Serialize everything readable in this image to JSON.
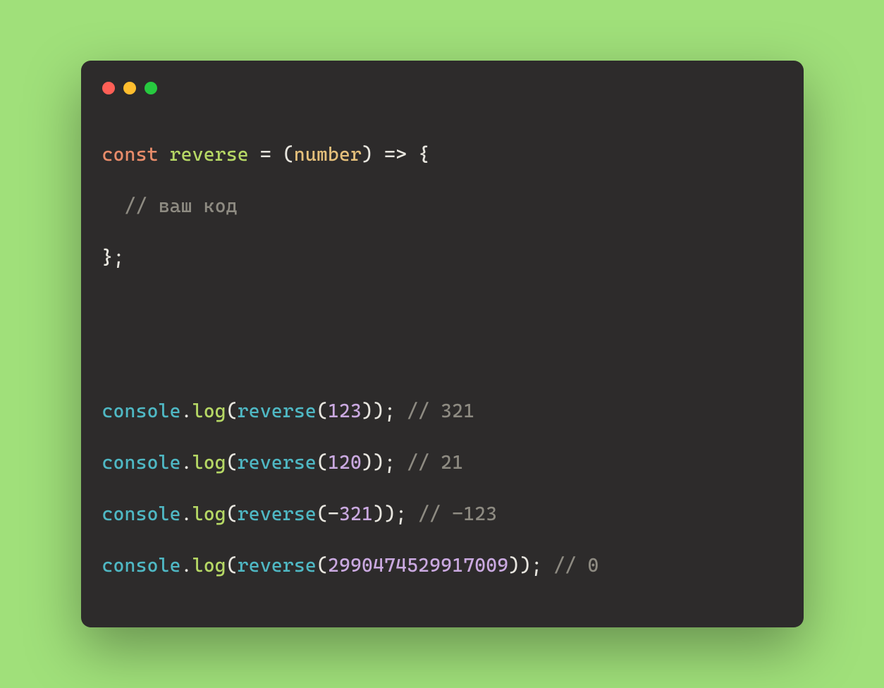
{
  "code": {
    "line1": {
      "kw": "const",
      "fn": "reverse",
      "param": "number"
    },
    "line2": {
      "comment": "// ваш код"
    },
    "call1": {
      "ident": "console",
      "method": "log",
      "fn": "reverse",
      "arg": "123",
      "comment": "// 321"
    },
    "call2": {
      "ident": "console",
      "method": "log",
      "fn": "reverse",
      "arg": "120",
      "comment": "// 21"
    },
    "call3": {
      "ident": "console",
      "method": "log",
      "fn": "reverse",
      "arg_prefix": "-",
      "arg": "321",
      "comment": "// -123"
    },
    "call4": {
      "ident": "console",
      "method": "log",
      "fn": "reverse",
      "arg": "2990474529917009",
      "comment": "// 0"
    }
  }
}
